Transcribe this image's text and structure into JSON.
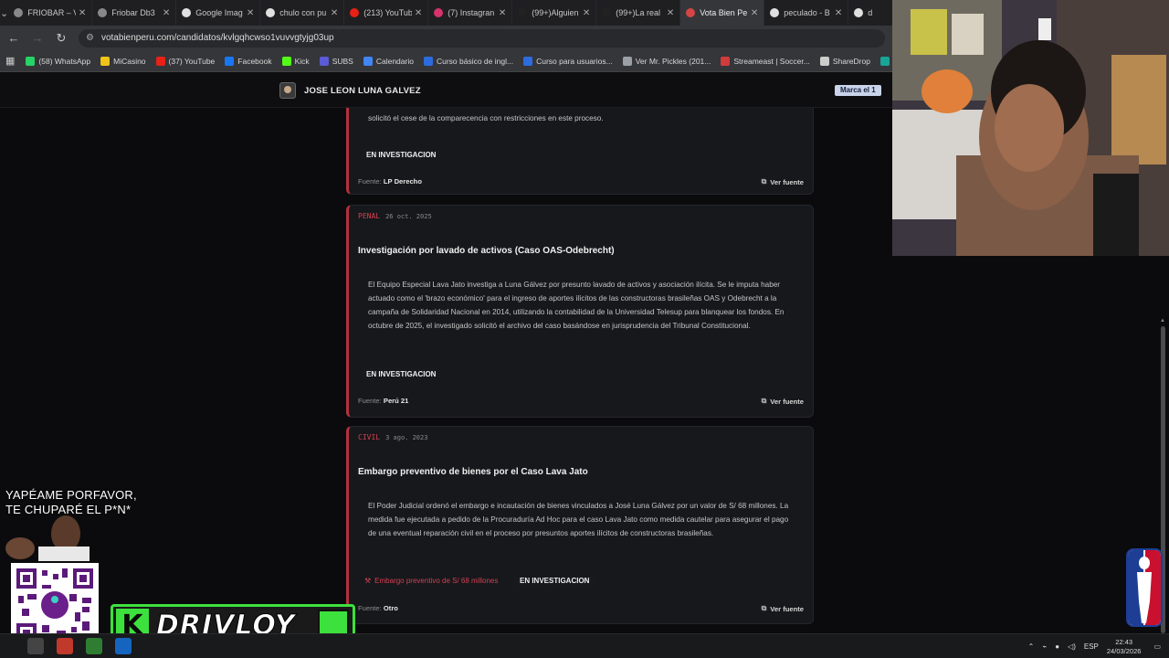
{
  "browser": {
    "tabs": [
      {
        "label": "FRIOBAR – V",
        "color": "#888888"
      },
      {
        "label": "Friobar Db3",
        "color": "#888888"
      },
      {
        "label": "Google Imag",
        "color": "#e0e0e0"
      },
      {
        "label": "chulo con pu",
        "color": "#e0e0e0"
      },
      {
        "label": "(213) YouTub",
        "color": "#e62117"
      },
      {
        "label": "(7) Instagran",
        "color": "#d6336c"
      },
      {
        "label": "(99+)Alguien",
        "color": "#222222"
      },
      {
        "label": "(99+)La real",
        "color": "#222222"
      },
      {
        "label": "Vota Bien Pe",
        "color": "#d64545"
      },
      {
        "label": "peculado - B",
        "color": "#e0e0e0"
      },
      {
        "label": "d",
        "color": "#e0e0e0"
      }
    ],
    "active_tab_index": 8,
    "url": "votabienperu.com/candidatos/kvlgqhcwso1vuvvgtyjg03up",
    "bookmarks": [
      {
        "label": "(58) WhatsApp",
        "color": "#25d366"
      },
      {
        "label": "MiCasino",
        "color": "#f0c419"
      },
      {
        "label": "(37) YouTube",
        "color": "#e62117"
      },
      {
        "label": "Facebook",
        "color": "#1877f2"
      },
      {
        "label": "Kick",
        "color": "#53fc18"
      },
      {
        "label": "SUBS",
        "color": "#5b5bd6"
      },
      {
        "label": "Calendario",
        "color": "#4285f4"
      },
      {
        "label": "Curso básico de ingl...",
        "color": "#2d6cdf"
      },
      {
        "label": "Curso para usuarios...",
        "color": "#2d6cdf"
      },
      {
        "label": "Ver Mr. Pickles (201...",
        "color": "#9aa0a6"
      },
      {
        "label": "Streameast | Soccer...",
        "color": "#d13b3b"
      },
      {
        "label": "ShareDrop",
        "color": "#cccccc"
      },
      {
        "label": "Photopea",
        "color": "#18a497"
      }
    ]
  },
  "site": {
    "candidate_name": "JOSE LEON LUNA GALVEZ",
    "marca_label": "Marca el 1"
  },
  "cards": [
    {
      "body": "solicitó el cese de la comparecencia con restricciones en este proceso.",
      "status": "EN INVESTIGACION",
      "source_label": "Fuente:",
      "source": "LP Derecho",
      "view_label": "Ver fuente"
    },
    {
      "category": "PENAL",
      "date": "26 oct. 2025",
      "title": "Investigación por lavado de activos (Caso OAS-Odebrecht)",
      "body": "El Equipo Especial Lava Jato investiga a Luna Gálvez por presunto lavado de activos y asociación ilícita. Se le imputa haber actuado como el 'brazo económico' para el ingreso de aportes ilícitos de las constructoras brasileñas OAS y Odebrecht a la campaña de Solidaridad Nacional en 2014, utilizando la contabilidad de la Universidad Telesup para blanquear los fondos. En octubre de 2025, el investigado solicitó el archivo del caso basándose en jurisprudencia del Tribunal Constitucional.",
      "status": "EN INVESTIGACION",
      "source_label": "Fuente:",
      "source": "Perú 21",
      "view_label": "Ver fuente"
    },
    {
      "category": "CIVIL",
      "date": "3 ago. 2023",
      "title": "Embargo preventivo de bienes por el Caso Lava Jato",
      "body": "El Poder Judicial ordenó el embargo e incautación de bienes vinculados a José Luna Gálvez por un valor de S/ 68 millones. La medida fue ejecutada a pedido de la Procuraduría Ad Hoc para el caso Lava Jato como medida cautelar para asegurar el pago de una eventual reparación civil en el proceso por presuntos aportes ilícitos de constructoras brasileñas.",
      "sentence": "Embargo preventivo de S/ 68 millones",
      "status": "EN INVESTIGACION",
      "source_label": "Fuente:",
      "source": "Otro",
      "view_label": "Ver fuente"
    }
  ],
  "overlay": {
    "line1": "YAPÉAME PORFAVOR,",
    "line2": "TE CHUPARÉ  EL P*N*",
    "logo_text": "DRIVLOY",
    "logo_letter": "K"
  },
  "taskbar": {
    "lang": "ESP",
    "time": "22:43",
    "date": "24/03/2026"
  },
  "colors": {
    "accent_red": "#d8404f",
    "card_border": "#b5303f",
    "brand_green": "#3de13d"
  }
}
